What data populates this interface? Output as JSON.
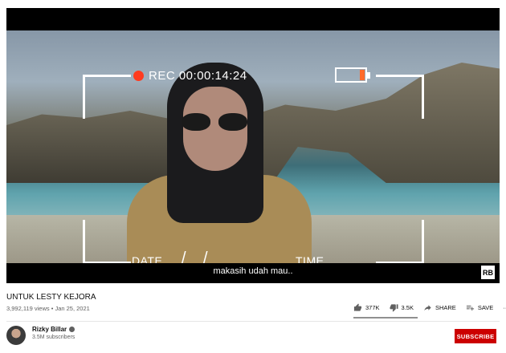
{
  "player": {
    "rec_label": "REC 00:00:14:24",
    "date_label": "DATE",
    "time_label": "TIME",
    "slash": "/",
    "subtitle": "makasih udah mau..",
    "logo_text": "RB"
  },
  "video": {
    "title": "UNTUK LESTY KEJORA",
    "meta": "3,992,119 views • Jan 25, 2021"
  },
  "actions": {
    "likes": "377K",
    "dislikes": "3.5K",
    "share": "SHARE",
    "save": "SAVE",
    "more": "···"
  },
  "channel": {
    "name": "Rizky Billar",
    "subscribers": "3.5M subscribers",
    "subscribe_label": "SUBSCRIBE"
  },
  "colors": {
    "subscribe": "#cc0000",
    "rec_dot": "#ff3b1f"
  }
}
